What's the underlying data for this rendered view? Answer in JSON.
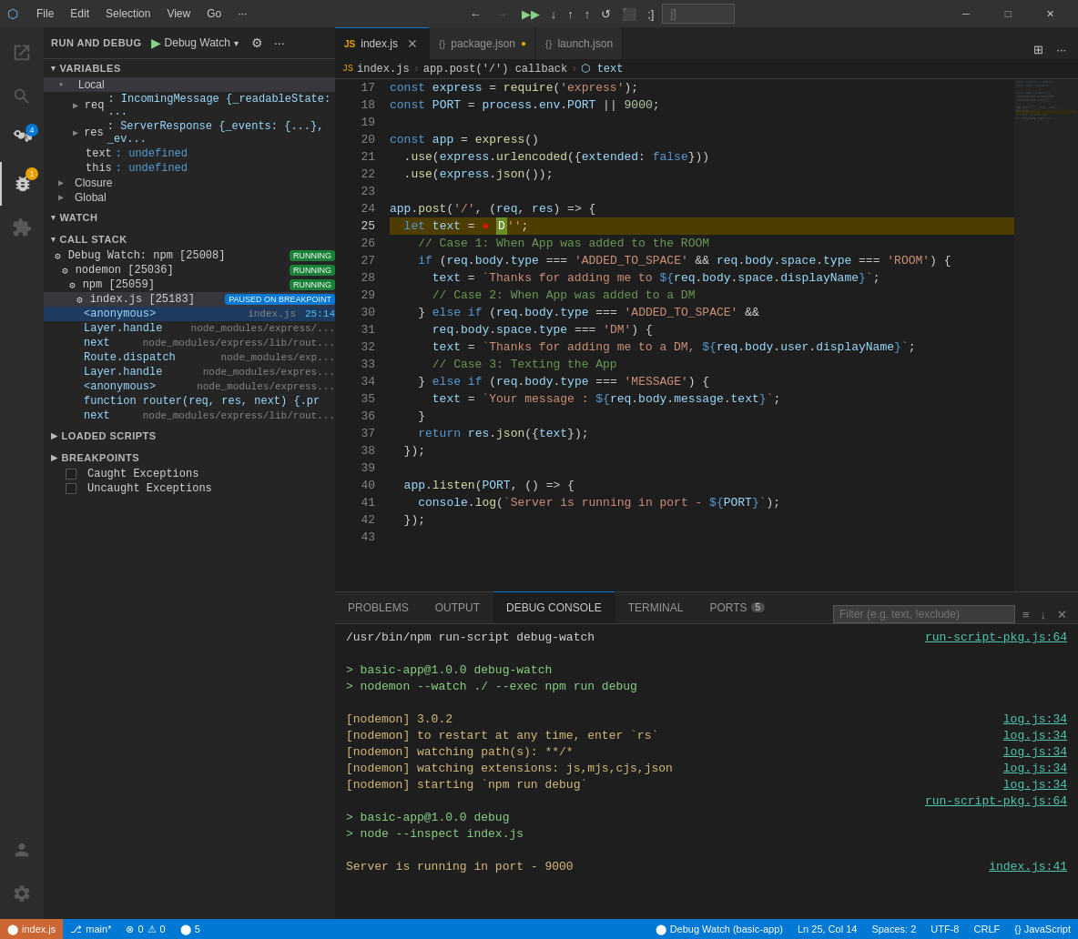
{
  "titlebar": {
    "icon": "⬡",
    "menu_items": [
      "File",
      "Edit",
      "Selection",
      "View",
      "Go",
      "···"
    ],
    "nav_back": "←",
    "nav_forward": "→",
    "search_placeholder": "",
    "debug_controls": [
      "▶▶",
      "↺",
      "↓",
      "↑",
      "⟳",
      "⬛",
      ";]"
    ],
    "window_controls": [
      "─",
      "□",
      "✕"
    ]
  },
  "sidebar": {
    "header": "RUN AND DEBUG",
    "debug_config": "Debug Watch",
    "variables": {
      "title": "VARIABLES",
      "local": {
        "title": "Local",
        "items": [
          {
            "name": "req",
            "value": "IncomingMessage {_readableState: ..."
          },
          {
            "name": "res",
            "value": "ServerResponse {_events: {...}, _ev..."
          },
          {
            "name": "text",
            "value": "undefined"
          },
          {
            "name": "this",
            "value": "undefined"
          }
        ]
      },
      "closure": "Closure",
      "global": "Global"
    },
    "watch": {
      "title": "WATCH"
    },
    "call_stack": {
      "title": "CALL STACK",
      "items": [
        {
          "label": "Debug Watch: npm [25008]",
          "badge": "RUNNING",
          "badge_type": "running",
          "indent": 0
        },
        {
          "label": "nodemon [25036]",
          "badge": "RUNNING",
          "badge_type": "running",
          "indent": 1
        },
        {
          "label": "npm [25059]",
          "badge": "RUNNING",
          "badge_type": "running",
          "indent": 2
        },
        {
          "label": "index.js [25183]",
          "badge": "PAUSED ON BREAKPOINT",
          "badge_type": "paused",
          "indent": 3
        },
        {
          "label": "<anonymous>",
          "file": "index.js",
          "line": "25:14",
          "indent": 4
        },
        {
          "label": "Layer.handle",
          "file": "node_modules/express/...",
          "indent": 4
        },
        {
          "label": "next",
          "file": "node_modules/express/lib/rout...",
          "indent": 4
        },
        {
          "label": "Route.dispatch",
          "file": "node_modules/exp...",
          "indent": 4
        },
        {
          "label": "Layer.handle",
          "file": "node_modules/expres...",
          "indent": 4
        },
        {
          "label": "<anonymous>",
          "file": "node_modules/express...",
          "indent": 4
        },
        {
          "label": "function router(req, res, next) {.pr",
          "indent": 4
        },
        {
          "label": "next",
          "file": "node_modules/express/lib/rout...",
          "indent": 4
        }
      ]
    },
    "loaded_scripts": {
      "title": "LOADED SCRIPTS"
    },
    "breakpoints": {
      "title": "BREAKPOINTS",
      "items": [
        {
          "label": "Caught Exceptions",
          "checked": false
        },
        {
          "label": "Uncaught Exceptions",
          "checked": false
        }
      ]
    }
  },
  "editor": {
    "tabs": [
      {
        "label": "index.js",
        "icon": "JS",
        "active": true,
        "modified": false
      },
      {
        "label": "package.json",
        "icon": "{}",
        "active": false,
        "modified": true
      },
      {
        "label": "launch.json",
        "icon": "{}",
        "active": false,
        "modified": false
      }
    ],
    "breadcrumb": [
      "index.js",
      "app.post('/') callback",
      "text"
    ],
    "filename": "index.js",
    "current_line": 25,
    "lines": [
      {
        "n": 17,
        "code": "const express = require('express');"
      },
      {
        "n": 18,
        "code": "const PORT = process.env.PORT || 9000;"
      },
      {
        "n": 19,
        "code": ""
      },
      {
        "n": 20,
        "code": "const app = express()"
      },
      {
        "n": 21,
        "code": "  .use(express.urlencoded({extended: false}))"
      },
      {
        "n": 22,
        "code": "  .use(express.json());"
      },
      {
        "n": 23,
        "code": ""
      },
      {
        "n": 24,
        "code": "app.post('/', (req, res) => {"
      },
      {
        "n": 25,
        "code": "  let text = ● D'';",
        "current": true
      },
      {
        "n": 26,
        "code": "    // Case 1: When App was added to the ROOM"
      },
      {
        "n": 27,
        "code": "    if (req.body.type === 'ADDED_TO_SPACE' && req.body.space.type === 'ROOM') {"
      },
      {
        "n": 28,
        "code": "      text = `Thanks for adding me to ${req.body.space.displayName}`;"
      },
      {
        "n": 29,
        "code": "      // Case 2: When App was added to a DM"
      },
      {
        "n": 30,
        "code": "    } else if (req.body.type === 'ADDED_TO_SPACE' &&"
      },
      {
        "n": 31,
        "code": "      req.body.space.type === 'DM') {"
      },
      {
        "n": 32,
        "code": "      text = `Thanks for adding me to a DM, ${req.body.user.displayName}`;"
      },
      {
        "n": 33,
        "code": "      // Case 3: Texting the App"
      },
      {
        "n": 34,
        "code": "    } else if (req.body.type === 'MESSAGE') {"
      },
      {
        "n": 35,
        "code": "      text = `Your message : ${req.body.message.text}`;"
      },
      {
        "n": 36,
        "code": "    }"
      },
      {
        "n": 37,
        "code": "    return res.json({text});"
      },
      {
        "n": 38,
        "code": "  });"
      },
      {
        "n": 39,
        "code": ""
      },
      {
        "n": 40,
        "code": "  app.listen(PORT, () => {"
      },
      {
        "n": 41,
        "code": "    console.log(`Server is running in port - ${PORT}`);"
      },
      {
        "n": 42,
        "code": "  });"
      },
      {
        "n": 43,
        "code": ""
      }
    ]
  },
  "panel": {
    "tabs": [
      "PROBLEMS",
      "OUTPUT",
      "DEBUG CONSOLE",
      "TERMINAL",
      "PORTS"
    ],
    "active_tab": "DEBUG CONSOLE",
    "ports_badge": "5",
    "filter_placeholder": "Filter (e.g. text, !exclude)",
    "terminal_lines": [
      {
        "text": "/usr/bin/npm run-script debug-watch",
        "style": "white"
      },
      {
        "text": "                                          run-script-pkg.js:64",
        "style": "link-right"
      },
      {
        "text": ""
      },
      {
        "text": "> basic-app@1.0.0 debug-watch",
        "style": "green-prompt"
      },
      {
        "text": "> nodemon --watch ./ --exec npm run debug",
        "style": "green-prompt"
      },
      {
        "text": ""
      },
      {
        "text": "[nodemon] 3.0.2",
        "style": "yellow",
        "right": "log.js:34"
      },
      {
        "text": "[nodemon] to restart at any time, enter `rs`",
        "style": "yellow",
        "right": "log.js:34"
      },
      {
        "text": "[nodemon] watching path(s): **/*",
        "style": "yellow",
        "right": "log.js:34"
      },
      {
        "text": "[nodemon] watching extensions: js,mjs,cjs,json",
        "style": "yellow",
        "right": "log.js:34"
      },
      {
        "text": "[nodemon] starting `npm run debug`",
        "style": "yellow",
        "right": "log.js:34"
      },
      {
        "text": "                                          run-script-pkg.js:64",
        "style": "link-right2"
      },
      {
        "text": ""
      },
      {
        "text": "> basic-app@1.0.0 debug",
        "style": "green-prompt"
      },
      {
        "text": "> node --inspect index.js",
        "style": "green-prompt"
      },
      {
        "text": ""
      },
      {
        "text": "Server is running in port - 9000",
        "style": "yellow",
        "right": "index.js:41"
      }
    ]
  },
  "status_bar": {
    "debug": "⬤ index.js",
    "branch": " main*",
    "errors": "⊗ 0  ⚠ 0",
    "notifications": "⬤ 5",
    "debug_watch": " Debug Watch (basic-app)",
    "position": "Ln 25, Col 14",
    "spaces": "Spaces: 2",
    "encoding": "UTF-8",
    "line_ending": "CRLF",
    "language": "{} JavaScript"
  }
}
